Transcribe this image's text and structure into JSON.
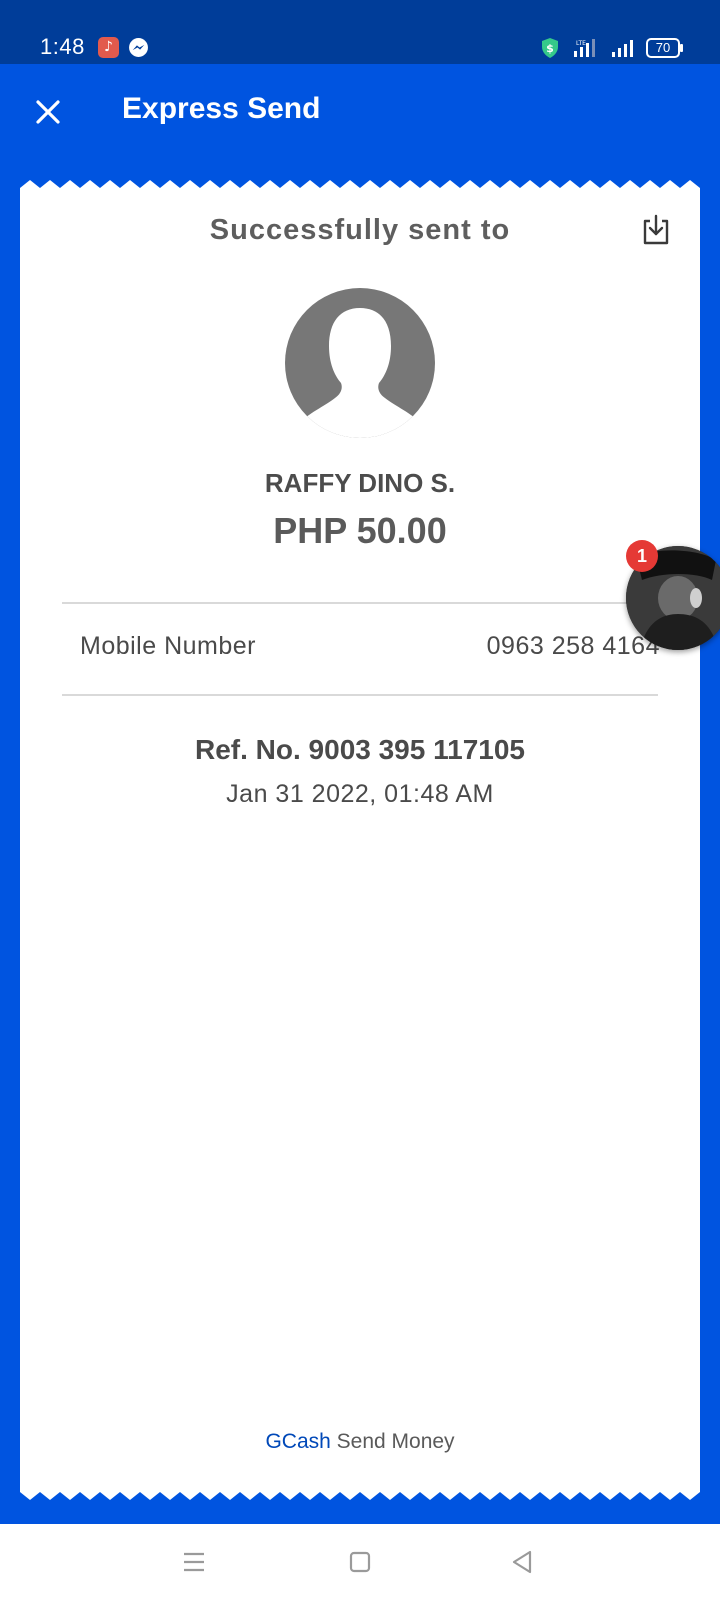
{
  "status_bar": {
    "time": "1:48",
    "battery": "70",
    "notification_icons": [
      "music-app-icon",
      "messenger-icon"
    ],
    "status_icons": [
      "shield-dollar-icon",
      "signal-lte-icon",
      "signal-icon",
      "battery-icon"
    ]
  },
  "header": {
    "title": "Express Send",
    "close_icon": "close-icon"
  },
  "receipt": {
    "success_title": "Successfully sent to",
    "download_icon": "download-icon",
    "recipient_name": "RAFFY DINO S.",
    "amount": "PHP 50.00",
    "details": {
      "label": "Mobile Number",
      "value": "0963 258 4164"
    },
    "ref_no": "Ref. No. 9003 395 117105",
    "date": "Jan 31 2022, 01:48 AM",
    "footer": {
      "brand": "GCash",
      "text": "Send Money"
    }
  },
  "chat_head": {
    "badge_count": "1"
  },
  "colors": {
    "brand_blue": "#0054e0",
    "status_bar": "#003d99",
    "text_gray": "#4a4a4a",
    "badge_red": "#e53935"
  }
}
